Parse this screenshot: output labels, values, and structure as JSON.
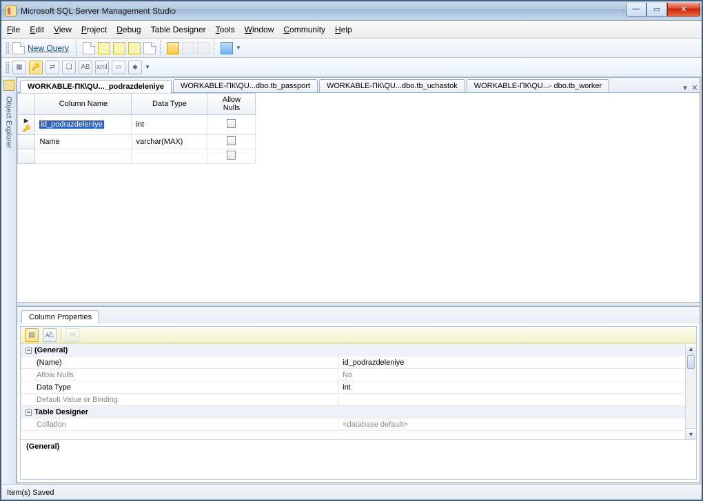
{
  "window": {
    "title": "Microsoft SQL Server Management Studio"
  },
  "menu": {
    "file": "File",
    "edit": "Edit",
    "view": "View",
    "project": "Project",
    "debug": "Debug",
    "table": "Table Designer",
    "tools": "Tools",
    "window": "Window",
    "community": "Community",
    "help": "Help"
  },
  "toolbar": {
    "new_query": "New Query"
  },
  "sidebar": {
    "object_explorer": "Object Explorer"
  },
  "tabs": [
    {
      "label": "WORKABLE-ПК\\QU..._podrazdeleniye",
      "active": true
    },
    {
      "label": "WORKABLE-ПК\\QU...dbo.tb_passport",
      "active": false
    },
    {
      "label": "WORKABLE-ПК\\QU...dbo.tb_uchastok",
      "active": false
    },
    {
      "label": "WORKABLE-ПК\\QU...- dbo.tb_worker",
      "active": false
    }
  ],
  "grid": {
    "headers": {
      "col": "Column Name",
      "type": "Data Type",
      "nulls": "Allow Nulls"
    },
    "rows": [
      {
        "pk": true,
        "selected": true,
        "name": "id_podrazdeleniye",
        "type": "int",
        "nulls": false
      },
      {
        "pk": false,
        "selected": false,
        "name": "Name",
        "type": "varchar(MAX)",
        "nulls": false
      }
    ]
  },
  "props": {
    "title": "Column Properties",
    "sort_label": "A↓",
    "categories": {
      "general": "(General)",
      "designer": "Table Designer"
    },
    "rows": {
      "name_k": "(Name)",
      "name_v": "id_podrazdeleniye",
      "nulls_k": "Allow Nulls",
      "nulls_v": "No",
      "dtype_k": "Data Type",
      "dtype_v": "int",
      "default_k": "Default Value or Binding",
      "default_v": "",
      "collation_k": "Collation",
      "collation_v": "<database default>"
    },
    "desc_head": "(General)"
  },
  "status": {
    "text": "Item(s) Saved"
  }
}
